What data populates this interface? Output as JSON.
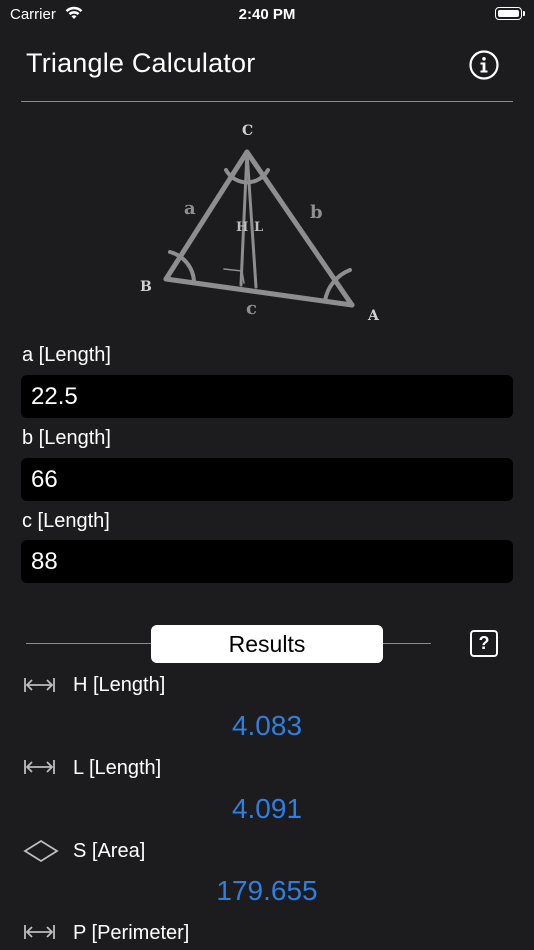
{
  "status_bar": {
    "carrier": "Carrier",
    "time": "2:40 PM"
  },
  "header": {
    "title": "Triangle Calculator",
    "info_icon": "info-circle-icon"
  },
  "diagram": {
    "vertex_labels": {
      "C": "C",
      "B": "B",
      "A": "A"
    },
    "side_labels": {
      "a": "a",
      "b": "b",
      "c": "c"
    },
    "inner_labels": {
      "H": "H",
      "L": "L"
    }
  },
  "inputs": [
    {
      "label": "a [Length]",
      "value": "22.5"
    },
    {
      "label": "b [Length]",
      "value": "66"
    },
    {
      "label": "c [Length]",
      "value": "88"
    }
  ],
  "results_section": {
    "button_label": "Results",
    "help_label": "?"
  },
  "results": [
    {
      "icon": "length-arrows-icon",
      "label": "H [Length]",
      "value": "4.083"
    },
    {
      "icon": "length-arrows-icon",
      "label": "L [Length]",
      "value": "4.091"
    },
    {
      "icon": "diamond-area-icon",
      "label": "S [Area]",
      "value": "179.655"
    },
    {
      "icon": "length-arrows-icon",
      "label": "P [Perimeter]",
      "value": ""
    }
  ],
  "colors": {
    "background": "#1c1c1e",
    "input_bg": "#000000",
    "result_value": "#2e7fe0",
    "divider": "#8a8a8e"
  }
}
